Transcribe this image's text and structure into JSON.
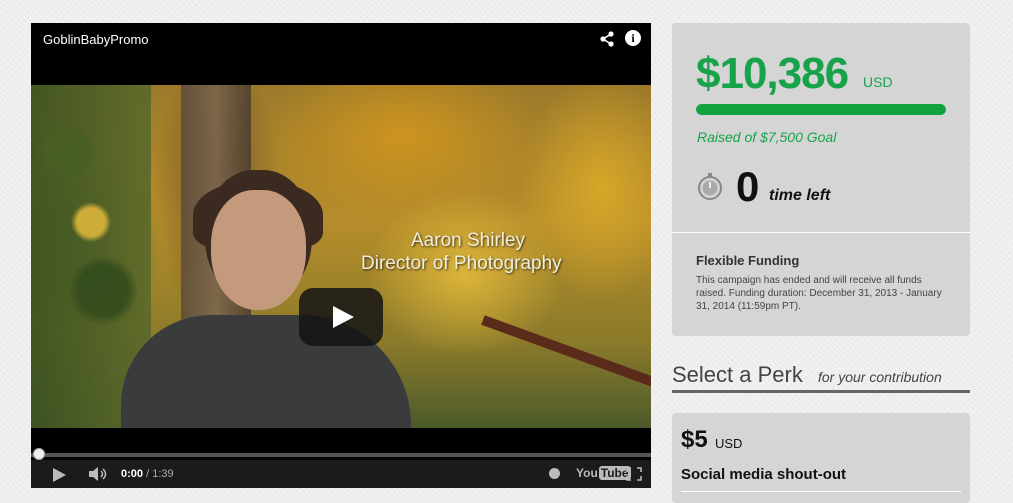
{
  "video": {
    "title": "GoblinBabyPromo",
    "overlay_name": "Aaron Shirley",
    "overlay_role": "Director of Photography",
    "current_time": "0:00",
    "duration": "1:39",
    "time_separator": " / ",
    "progress": 0.0,
    "youtube_logo": {
      "you": "You",
      "tube": "Tube"
    }
  },
  "funding": {
    "amount": "$10,386",
    "currency": "USD",
    "goal_text": "Raised of $7,500 Goal",
    "progress": 1.0,
    "time_left_value": "0",
    "time_left_label": "time left",
    "funding_type": "Flexible Funding",
    "description": "This campaign has ended and will receive all funds raised. Funding duration: December 31, 2013 - January 31, 2014 (11:59pm PT).",
    "accent_color": "#16a34a"
  },
  "perks": {
    "heading": "Select a Perk",
    "subheading": "for your contribution",
    "items": [
      {
        "price": "$5",
        "currency": "USD",
        "title": "Social media shout-out"
      }
    ]
  }
}
